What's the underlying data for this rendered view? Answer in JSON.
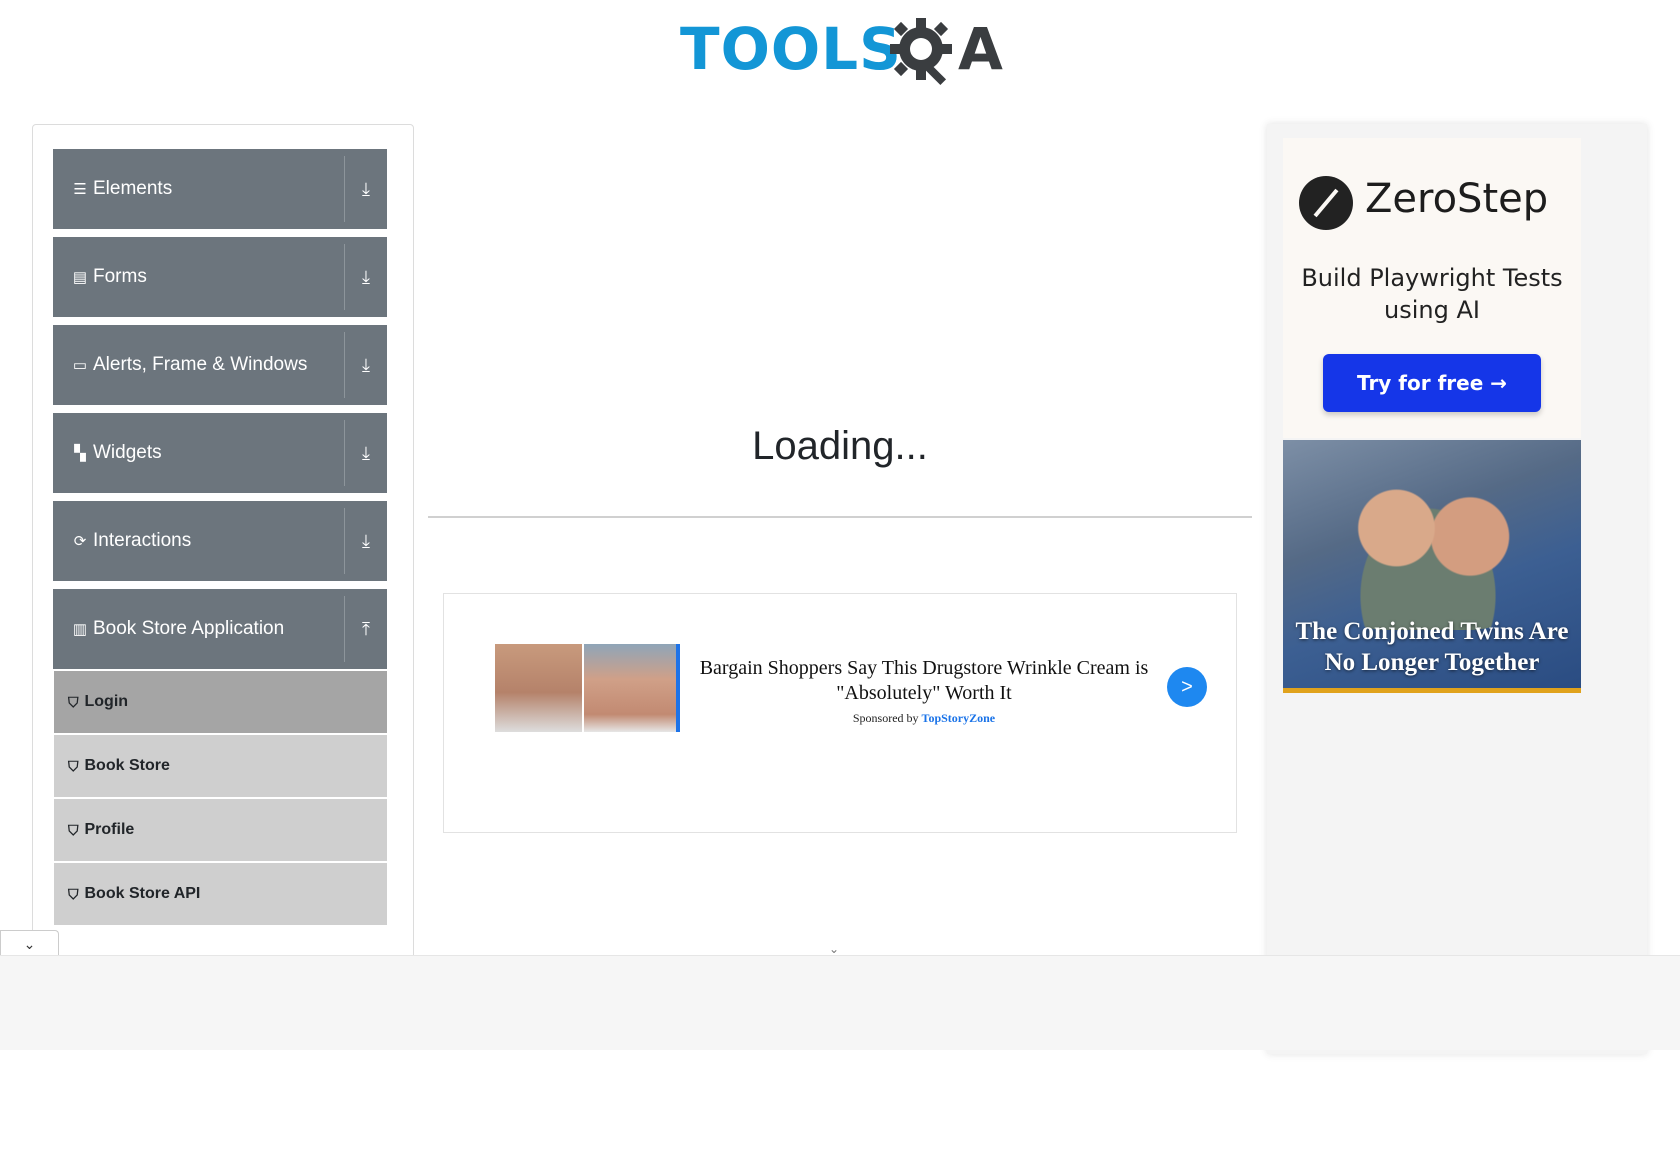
{
  "header": {
    "logo_tools": "TOOLS",
    "logo_a": "A"
  },
  "sidebar": {
    "groups": [
      {
        "label": "Elements",
        "icon": "hamburger-icon",
        "arrow": "⤓"
      },
      {
        "label": "Forms",
        "icon": "form-icon",
        "arrow": "⤓"
      },
      {
        "label": "Alerts, Frame & Windows",
        "icon": "window-icon",
        "arrow": "⤓"
      },
      {
        "label": "Widgets",
        "icon": "widgets-icon",
        "arrow": "⤓"
      },
      {
        "label": "Interactions",
        "icon": "interactions-icon",
        "arrow": "⤓"
      },
      {
        "label": "Book Store Application",
        "icon": "books-icon",
        "arrow": "⤒"
      }
    ],
    "items": [
      {
        "label": "Login",
        "active": true
      },
      {
        "label": "Book Store",
        "active": false
      },
      {
        "label": "Profile",
        "active": false
      },
      {
        "label": "Book Store API",
        "active": false
      }
    ]
  },
  "main": {
    "loading": "Loading...",
    "ad": {
      "title": "Bargain Shoppers Say This Drugstore Wrinkle Cream is \"Absolutely\" Worth It",
      "sponsor_prefix": "Sponsored by",
      "sponsor_name": "TopStoryZone",
      "next": ">"
    }
  },
  "right_ad": {
    "brand": "ZeroStep",
    "tagline": "Build Playwright Tests using AI",
    "cta": "Try for free →",
    "story_headline": "The Conjoined Twins Are No Longer Together"
  },
  "sticky": {
    "toggle": "⌄",
    "chevron": "⌄"
  },
  "colors": {
    "sidebar_group": "#6c757d",
    "sub_item": "#cfcfcf",
    "sub_item_active": "#a5a5a5",
    "logo_blue": "#1396d6",
    "cta_blue": "#1536e8"
  }
}
